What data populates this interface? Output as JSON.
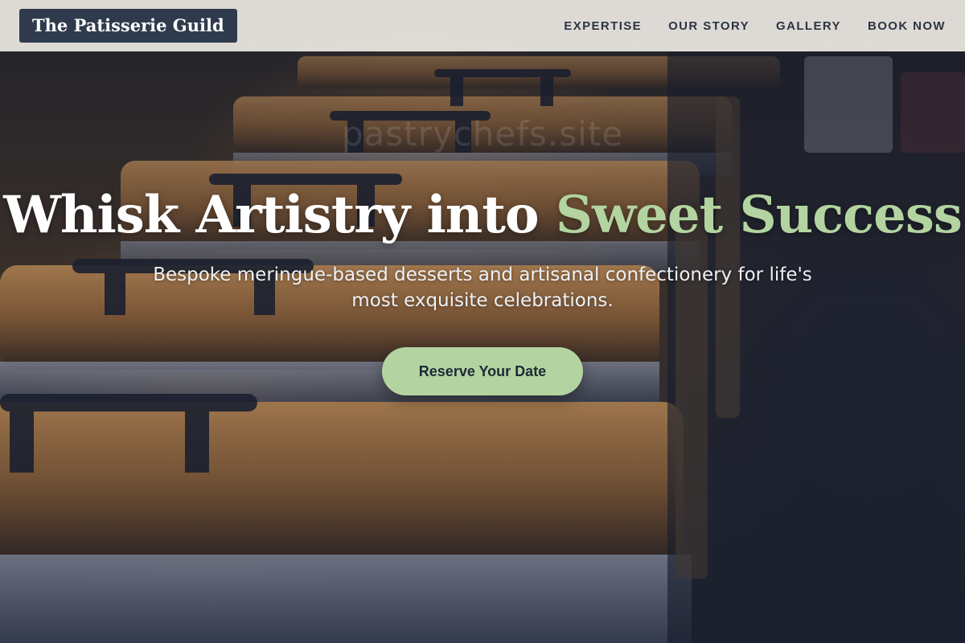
{
  "brand": {
    "name": "The Patisserie Guild"
  },
  "nav": {
    "items": [
      {
        "label": "EXPERTISE"
      },
      {
        "label": "OUR STORY"
      },
      {
        "label": "GALLERY"
      },
      {
        "label": "BOOK NOW"
      }
    ]
  },
  "hero": {
    "headline_main": "Whisk Artistry into ",
    "headline_accent": "Sweet Success",
    "subtitle": "Bespoke meringue-based desserts and artisanal confectionery for life's most exquisite celebrations.",
    "watermark": "pastrychefs.site",
    "cta_label": "Reserve Your Date",
    "background_image": "chafing-dishes-photo"
  },
  "colors": {
    "accent": "#b3d4a0",
    "brand_bg": "#2f3b4d",
    "nav_bg": "#eeeae4",
    "nav_text": "#2c3442"
  }
}
